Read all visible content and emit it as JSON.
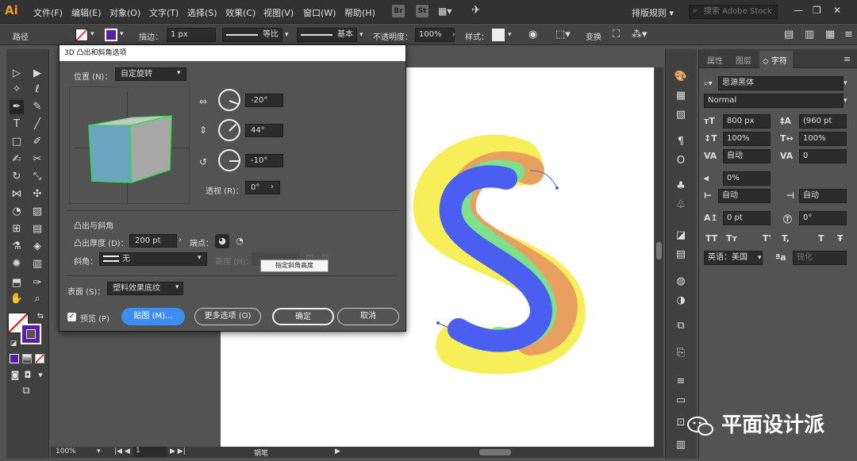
{
  "app": {
    "logo": "Ai"
  },
  "menubar": {
    "items": [
      "文件(F)",
      "编辑(E)",
      "对象(O)",
      "文字(T)",
      "选择(S)",
      "效果(C)",
      "视图(V)",
      "窗口(W)",
      "帮助(H)"
    ],
    "icons": [
      "Br",
      "St"
    ],
    "layout_menu": "排版规则",
    "search_placeholder": "搜索 Adobe Stock",
    "window_controls": [
      "—",
      "❐",
      "✕"
    ]
  },
  "control_bar": {
    "path_label": "路径",
    "stroke_label": "描边：",
    "stroke_value": "1 px",
    "profile_label": "等比",
    "brush_label": "基本",
    "opacity_label": "不透明度：",
    "opacity_value": "100%",
    "style_label": "样式：",
    "transform_label": "变换"
  },
  "dialog": {
    "title": "3D 凸出和斜角选项",
    "position_label": "位置 (N)：",
    "position_value": "自定旋转",
    "rot_x": "-20°",
    "rot_y": "44°",
    "rot_z": "-10°",
    "perspective_label": "透视 (R)：",
    "perspective_value": "0°",
    "extrude_section": "凸出与斜角",
    "extrude_depth_label": "凸出厚度 (D)：",
    "extrude_depth_value": "200 pt",
    "cap_label": "端点：",
    "bevel_label": "斜角：",
    "bevel_value": "无",
    "height_label": "高度 (H)：",
    "surface_label": "表面 (S)：",
    "surface_value": "塑料效果底纹",
    "preview_label": "预览 (P)",
    "map_button": "贴图 (M)...",
    "more_button": "更多选项 (O)",
    "ok_button": "确定",
    "cancel_button": "取消",
    "tooltip": "指定斜角高度"
  },
  "char_panel": {
    "tabs": [
      "属性",
      "图层",
      "字符"
    ],
    "font_family": "思源黑体",
    "font_style": "Normal",
    "font_size": "800 px",
    "leading": "(960 pt",
    "vscale": "100%",
    "hscale": "100%",
    "kerning": "自动",
    "tracking": "0",
    "tsume": "0%",
    "aki_left": "自动",
    "aki_right": "自动",
    "baseline": "0 pt",
    "rotation": "0°",
    "style_buttons": [
      "TT",
      "Tт",
      "T'",
      "T,",
      "T",
      "Ŧ"
    ],
    "language": "英语：美国",
    "aa_value": "锐化"
  },
  "status": {
    "zoom": "100%",
    "page": "1",
    "tool_name": "钢笔"
  },
  "watermark": "平面设计派",
  "colors": {
    "accent": "#3d8ef0",
    "fill_swatch": "#ffffff",
    "stroke_swatch": "#5a1fa8",
    "cube_front": "#6aa5c0",
    "cube_top": "#c8c8c8",
    "cube_side": "#a8a8a8",
    "cube_edge": "#2ee04a"
  }
}
